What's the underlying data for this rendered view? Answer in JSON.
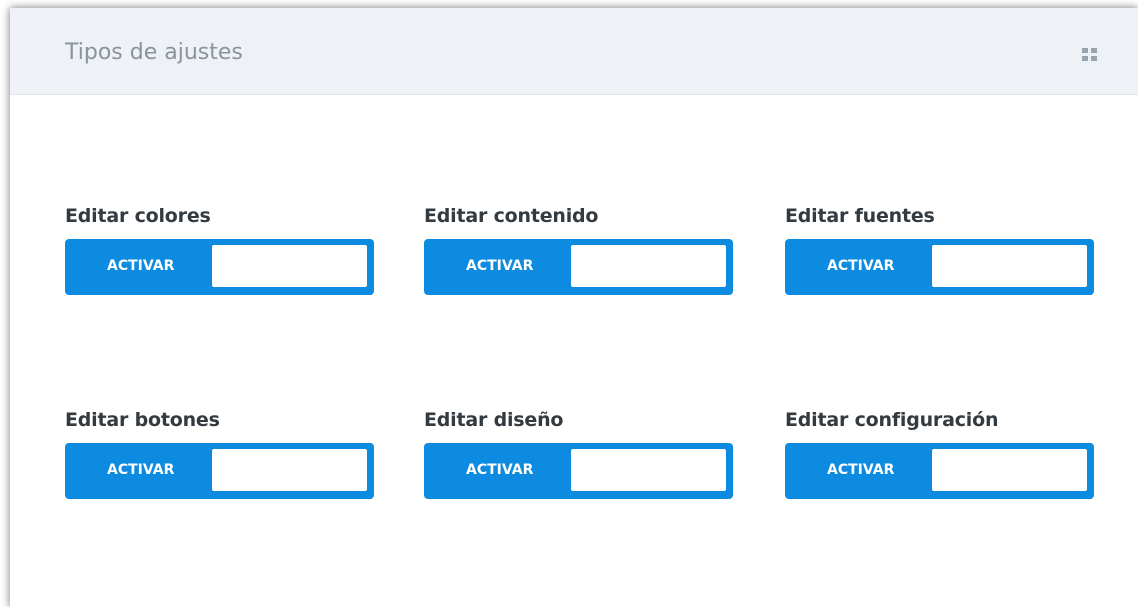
{
  "panel": {
    "title": "Tipos de ajustes",
    "header_icon": "grid-icon"
  },
  "settings": [
    {
      "label": "Editar colores",
      "toggle_label": "ACTIVAR"
    },
    {
      "label": "Editar contenido",
      "toggle_label": "ACTIVAR"
    },
    {
      "label": "Editar fuentes",
      "toggle_label": "ACTIVAR"
    },
    {
      "label": "Editar botones",
      "toggle_label": "ACTIVAR"
    },
    {
      "label": "Editar diseño",
      "toggle_label": "ACTIVAR"
    },
    {
      "label": "Editar configuración",
      "toggle_label": "ACTIVAR"
    }
  ],
  "colors": {
    "accent": "#0c8be0",
    "header_bg": "#eef2f7"
  }
}
